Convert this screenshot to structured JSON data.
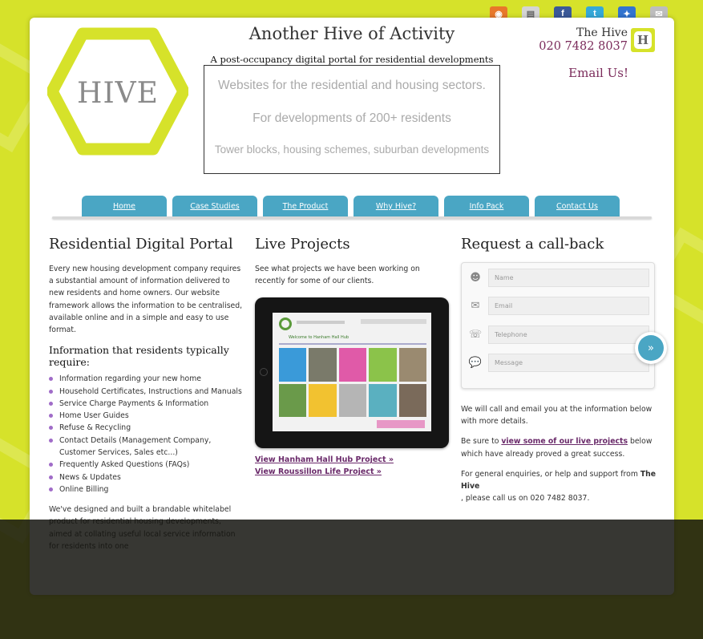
{
  "social": {
    "icons": [
      "rss-icon",
      "print-icon",
      "facebook-icon",
      "twitter-icon",
      "delicious-icon",
      "mail-icon"
    ],
    "colors": [
      "#e8782a",
      "#cccccc",
      "#3b5998",
      "#35a8d8",
      "#3274d0",
      "#9a9a9a"
    ]
  },
  "logo": {
    "text": "HIVE",
    "color": "#d6e22a"
  },
  "header": {
    "title": "Another Hive of Activity",
    "tagline": "A post-occupancy digital portal for residential developments"
  },
  "banner": {
    "line1": "Websites for the residential and housing sectors.",
    "line2": "For developments of 200+ residents",
    "line3": "Tower blocks, housing schemes, suburban developments"
  },
  "contact": {
    "name": "The Hive",
    "phone": "020 7482 8037",
    "badge": "H",
    "email_label": "Email Us!"
  },
  "nav": {
    "items": [
      "Home",
      "Case Studies",
      "The Product",
      "Why Hive?",
      "Info Pack",
      "Contact Us"
    ]
  },
  "portal": {
    "heading": "Residential Digital Portal",
    "intro": "Every new housing development company requires a substantial amount of information delivered to new residents and home owners. Our website framework allows the information to be centralised, available online and in a simple and easy to use format.",
    "subheading": "Information that residents typically require:",
    "items": [
      "Information regarding your new home",
      "Household Certificates, Instructions and Manuals",
      "Service Charge Payments & Information",
      "Home User Guides",
      "Refuse & Recycling",
      "Contact Details (Management Company, Customer Services, Sales etc...)",
      "Frequently Asked Questions (FAQs)",
      "News & Updates",
      "Online Billing"
    ],
    "outro": "We've designed and built a brandable whitelabel product for residential housing developments, aimed at collating useful local service information for residents into one"
  },
  "projects": {
    "heading": "Live Projects",
    "intro": "See what projects we have been working on recently for some of our clients.",
    "link1": "View Hanham Hall Hub Project »",
    "link2": "View Roussillon Life Project »",
    "screen": {
      "title": "Welcome to Hanham Hall Hub",
      "tiles": [
        "#3a9ad9",
        "#e05aa8",
        "#8bc34a",
        "#f2c230",
        "#7a7a7a",
        "#5ab0c0",
        "#9a8a70",
        "#c8c8c8",
        "#6a9a4a"
      ]
    }
  },
  "callback": {
    "heading": "Request a call-back",
    "fields": [
      {
        "icon": "person-icon",
        "placeholder": "Name"
      },
      {
        "icon": "envelope-icon",
        "placeholder": "Email"
      },
      {
        "icon": "phone-icon",
        "placeholder": "Telephone"
      },
      {
        "icon": "speech-bubble-icon",
        "placeholder": "Message"
      }
    ],
    "submit": "»",
    "p1": "We will call and email you at the information below with more details.",
    "p2_pre": "Be sure to ",
    "p2_link": "view some of our live projects",
    "p2_post": " below which have already proved a great success.",
    "p3_pre": "For general enquiries, or help and support from ",
    "p3_bold": "The Hive",
    "p3_post": ", please call us on 020 7482 8037."
  }
}
